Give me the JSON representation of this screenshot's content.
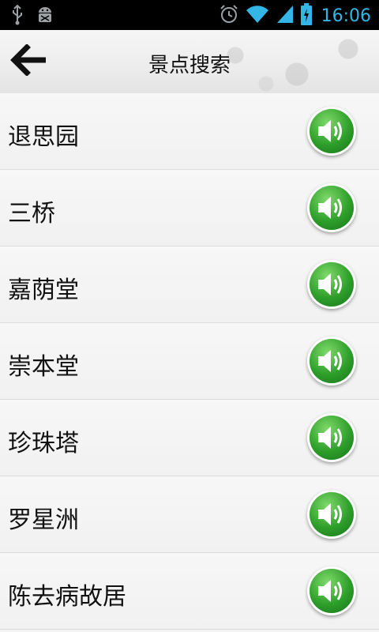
{
  "status_bar": {
    "time": "16:06",
    "icons": [
      "usb-icon",
      "android-debug-icon",
      "alarm-icon",
      "wifi-icon",
      "signal-icon",
      "battery-charging-icon"
    ],
    "accent_color": "#33b5e5"
  },
  "header": {
    "title": "景点搜索",
    "back_icon": "back-arrow-icon"
  },
  "list": {
    "items": [
      {
        "label": "退思园"
      },
      {
        "label": "三桥"
      },
      {
        "label": "嘉荫堂"
      },
      {
        "label": "崇本堂"
      },
      {
        "label": "珍珠塔"
      },
      {
        "label": "罗星洲"
      },
      {
        "label": "陈去病故居"
      }
    ],
    "action_icon": "speaker-icon",
    "action_color": "#2e9f2a"
  }
}
